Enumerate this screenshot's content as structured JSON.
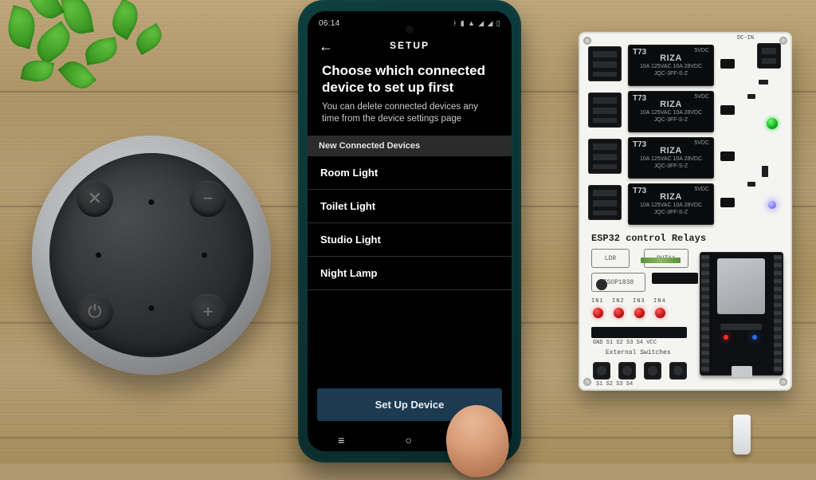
{
  "phone": {
    "status": {
      "time": "06:14",
      "icons": [
        "bt",
        "vib",
        "wifi",
        "sig1",
        "sig2",
        "batt"
      ]
    },
    "header_title": "SETUP",
    "title": "Choose which connected device to set up first",
    "subtitle": "You can delete connected devices any time from the device settings page",
    "section_header": "New Connected Devices",
    "devices": [
      "Room Light",
      "Toilet Light",
      "Studio Light",
      "Night Lamp"
    ],
    "primary_button": "Set Up Device"
  },
  "pcb": {
    "title_label": "ESP32 control Relays",
    "relay_brand": "RIZA",
    "relay_model": "T73",
    "relay_spec1": "10A 125VAC  10A 28VDC",
    "relay_spec2": "JQC-3FF-S-Z",
    "relay_coil": "5VDC",
    "dc_in": "DC-IN",
    "ext_sw": "External Switches",
    "ldr": "LDR",
    "dht": "DHT11",
    "tsop": "TSOP1838",
    "in_labels": [
      "IN1",
      "IN2",
      "IN3",
      "IN4"
    ],
    "sw_row": "GND  S1  S2  S3  S4  VCC",
    "btn_row": "S1      S2      S3      S4"
  }
}
